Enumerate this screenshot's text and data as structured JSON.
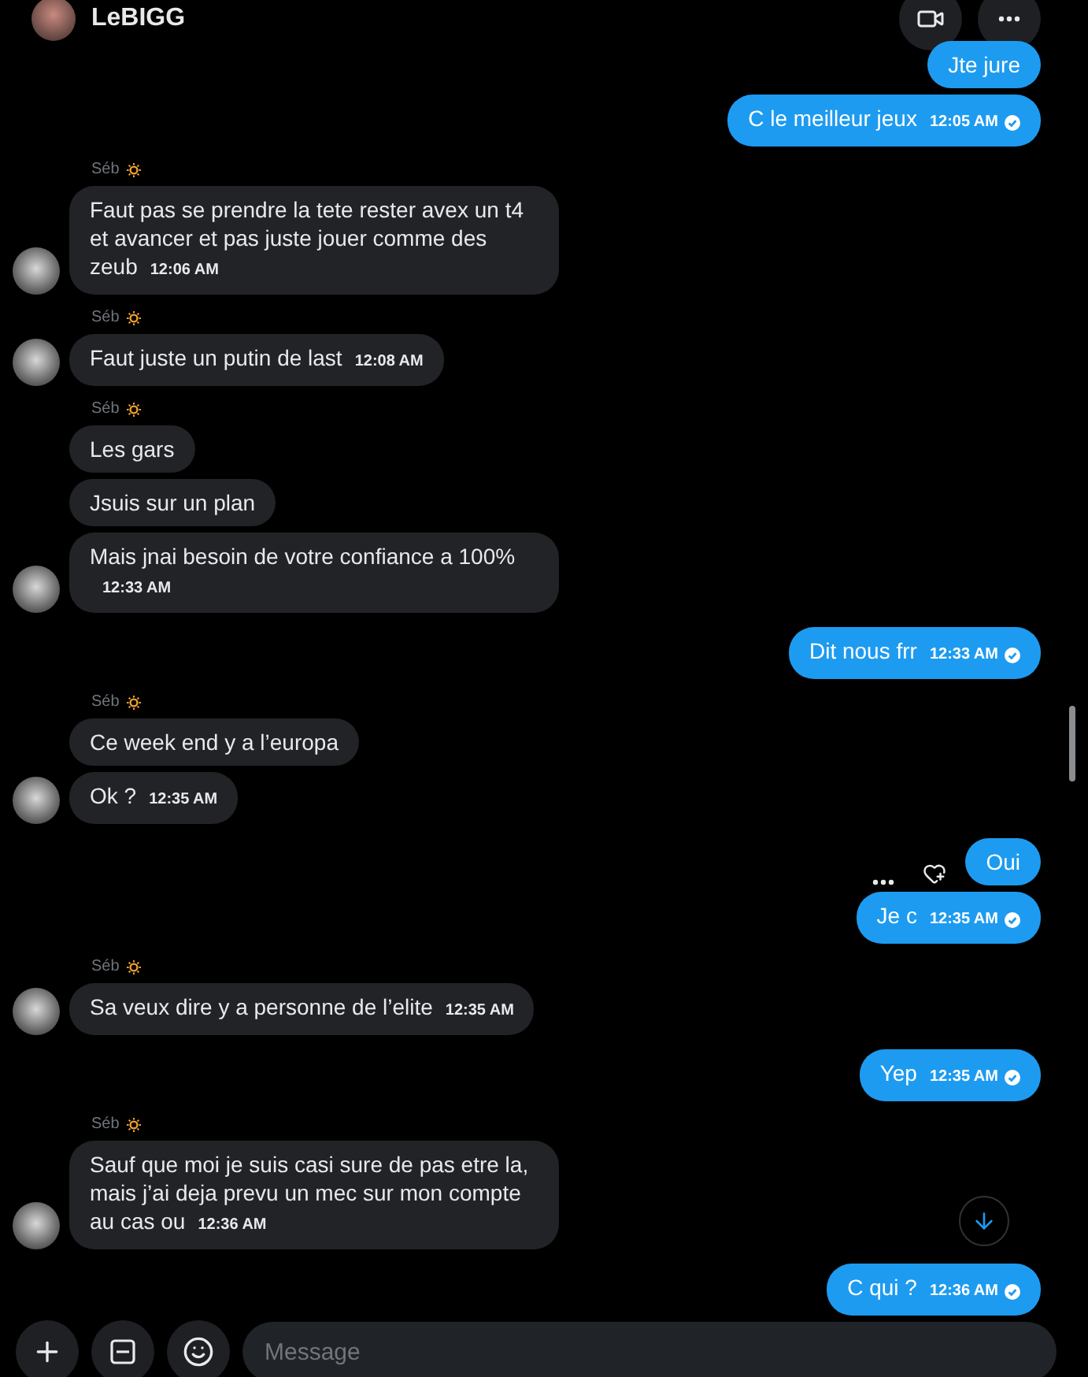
{
  "header": {
    "name": "LeBIGG"
  },
  "groups": [
    {
      "kind": "out",
      "messages": [
        {
          "text": "Jte jure",
          "sent": false,
          "hovered": false
        },
        {
          "text": "C le meilleur jeux",
          "time": "12:05 AM",
          "sent": true,
          "hovered": false
        }
      ]
    },
    {
      "kind": "in",
      "sender": "Séb",
      "messages": [
        {
          "text": "Faut pas se prendre la tete rester avex un t4 et avancer et pas juste jouer comme des zeub",
          "time": "12:06 AM"
        }
      ]
    },
    {
      "kind": "in",
      "sender": "Séb",
      "messages": [
        {
          "text": "Faut juste un putin de last",
          "time": "12:08 AM"
        }
      ]
    },
    {
      "kind": "in",
      "sender": "Séb",
      "messages": [
        {
          "text": "Les gars"
        },
        {
          "text": "Jsuis sur un plan"
        },
        {
          "text": "Mais jnai besoin de votre confiance a 100%",
          "time": "12:33 AM"
        }
      ]
    },
    {
      "kind": "out",
      "messages": [
        {
          "text": "Dit nous frr",
          "time": "12:33 AM",
          "sent": true,
          "hovered": false
        }
      ]
    },
    {
      "kind": "in",
      "sender": "Séb",
      "messages": [
        {
          "text": "Ce week end y a l’europa"
        },
        {
          "text": "Ok ?",
          "time": "12:35 AM"
        }
      ]
    },
    {
      "kind": "out",
      "messages": [
        {
          "text": "Oui",
          "sent": false,
          "hovered": true
        },
        {
          "text": "Je c",
          "time": "12:35 AM",
          "sent": true,
          "hovered": false
        }
      ]
    },
    {
      "kind": "in",
      "sender": "Séb",
      "messages": [
        {
          "text": "Sa veux dire y a personne de l’elite",
          "time": "12:35 AM"
        }
      ]
    },
    {
      "kind": "out",
      "messages": [
        {
          "text": "Yep",
          "time": "12:35 AM",
          "sent": true,
          "hovered": false
        }
      ]
    },
    {
      "kind": "in",
      "sender": "Séb",
      "messages": [
        {
          "text": "Sauf que moi je suis casi sure de pas etre la, mais j’ai deja prevu un mec sur mon compte au cas ou",
          "time": "12:36 AM"
        }
      ]
    },
    {
      "kind": "out",
      "messages": [
        {
          "text": "C qui ?",
          "time": "12:36 AM",
          "sent": true,
          "hovered": false
        }
      ]
    }
  ],
  "composer": {
    "placeholder": "Message"
  }
}
